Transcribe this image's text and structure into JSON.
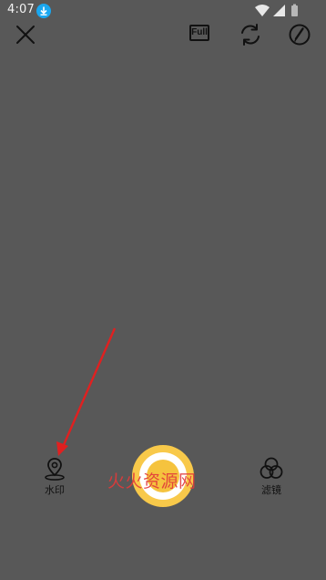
{
  "status_bar": {
    "time": "4:07"
  },
  "toolbar": {
    "full_label": "Full"
  },
  "bottom": {
    "watermark_label": "水印",
    "filter_label": "滤镜"
  },
  "overlay": {
    "watermark_text": "火火资源网"
  },
  "colors": {
    "background": "#585858",
    "accent": "#f8c94a",
    "arrow": "#e02020",
    "download_badge": "#1aa7f0"
  }
}
